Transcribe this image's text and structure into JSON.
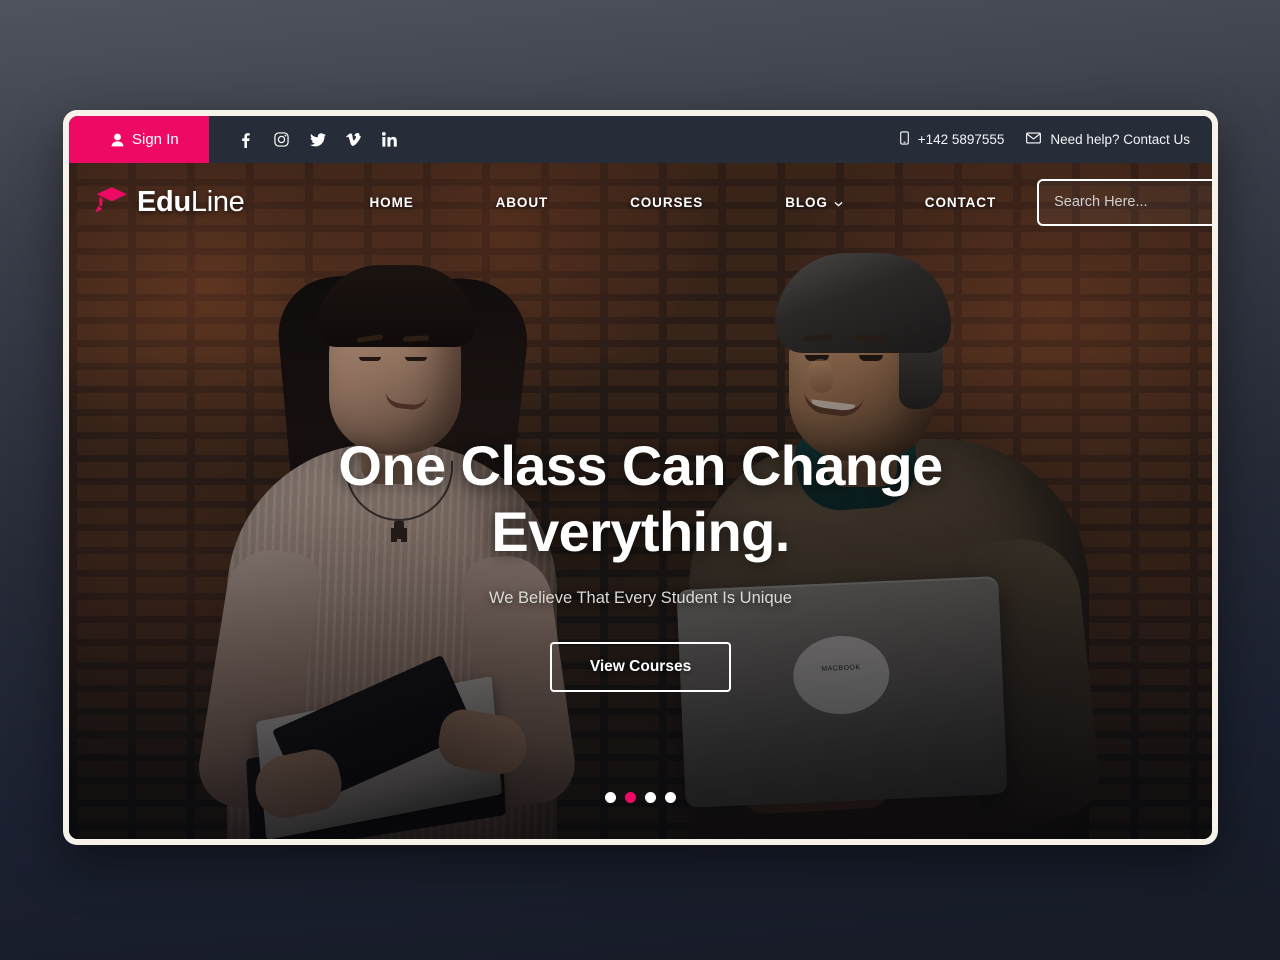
{
  "theme": {
    "accent": "#ee0a64",
    "topbar_bg": "#272c39",
    "frame_bg": "#f6f2ea",
    "page_bg_top": "#4f535c",
    "page_bg_bottom": "#171b27"
  },
  "topbar": {
    "signin_label": "Sign In",
    "signin_icon": "user-icon",
    "social": [
      {
        "name": "facebook-icon",
        "label": "f"
      },
      {
        "name": "instagram-icon",
        "label": ""
      },
      {
        "name": "twitter-icon",
        "label": ""
      },
      {
        "name": "vimeo-icon",
        "label": "v"
      },
      {
        "name": "linkedin-icon",
        "label": "in"
      }
    ],
    "phone": "+142 5897555",
    "phone_icon": "mobile-icon",
    "contact": "Need help? Contact Us",
    "contact_icon": "envelope-icon"
  },
  "header": {
    "logo": {
      "icon": "graduation-cap-icon",
      "bold": "Edu",
      "light": "Line"
    },
    "nav": [
      {
        "label": "HOME",
        "has_dropdown": false
      },
      {
        "label": "ABOUT",
        "has_dropdown": false
      },
      {
        "label": "COURSES",
        "has_dropdown": false
      },
      {
        "label": "BLOG",
        "has_dropdown": true
      },
      {
        "label": "CONTACT",
        "has_dropdown": false
      }
    ],
    "search": {
      "placeholder": "Search Here...",
      "value": "",
      "button_icon": "search-icon"
    }
  },
  "hero": {
    "title": "One Class Can Change Everything.",
    "subtitle": "We Believe That Every Student Is Unique",
    "cta_label": "View Courses",
    "laptop_sticker_text": "MACBOOK",
    "carousel": {
      "slide_count": 4,
      "active_index": 1
    }
  }
}
